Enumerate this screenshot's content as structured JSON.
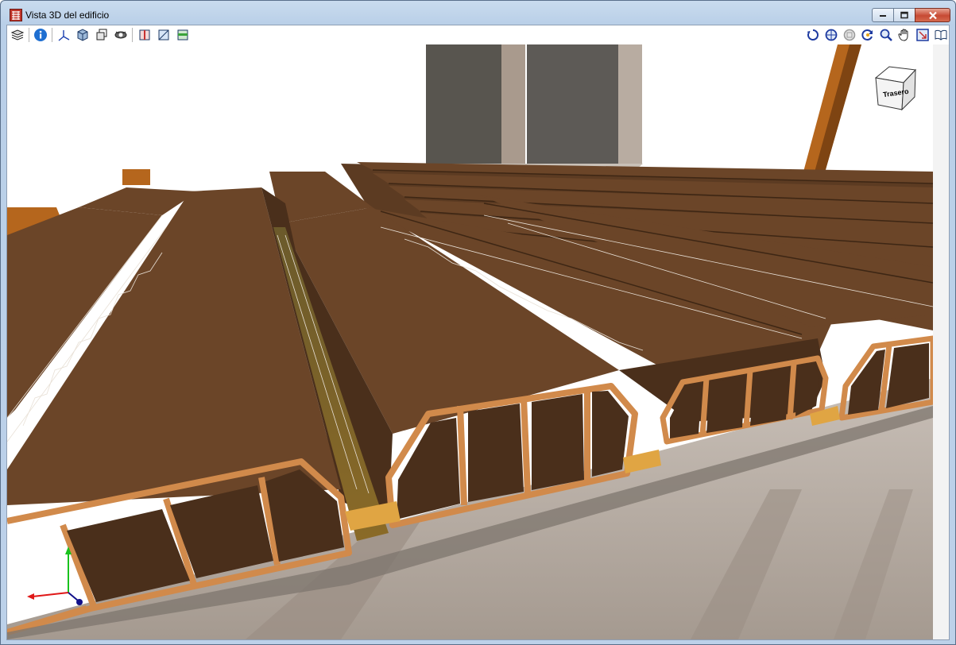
{
  "window": {
    "title": "Vista 3D del edificio",
    "controls": [
      "minimize",
      "restore",
      "close"
    ]
  },
  "toolbar": {
    "left_tools": [
      {
        "name": "layers-icon"
      },
      {
        "name": "info-icon"
      },
      {
        "name": "axes-icon"
      },
      {
        "name": "solid-view-icon"
      },
      {
        "name": "wireframe-view-icon"
      },
      {
        "name": "render-view-icon"
      },
      {
        "name": "section-plane-icon"
      },
      {
        "name": "clip-box-icon"
      },
      {
        "name": "floor-plan-icon"
      }
    ],
    "right_tools": [
      {
        "name": "rotate-icon"
      },
      {
        "name": "orbit-icon"
      },
      {
        "name": "zoom-window-icon"
      },
      {
        "name": "zoom-refresh-icon"
      },
      {
        "name": "zoom-icon"
      },
      {
        "name": "pan-hand-icon"
      },
      {
        "name": "fit-view-icon"
      },
      {
        "name": "book-icon"
      }
    ],
    "help_label": "?"
  },
  "viewcube": {
    "face_label": "Trasero"
  },
  "colors": {
    "slab_top": "#6b4528",
    "slab_side": "#4a2f1b",
    "hollow_core_edge": "#d18a4b",
    "beam": "#e0a543",
    "floor": "#b6aaa0",
    "column": "#5d5a56",
    "orange_beam": "#b5661d",
    "axis_x": "#e01818",
    "axis_y": "#19c21d",
    "axis_z": "#10108a"
  }
}
